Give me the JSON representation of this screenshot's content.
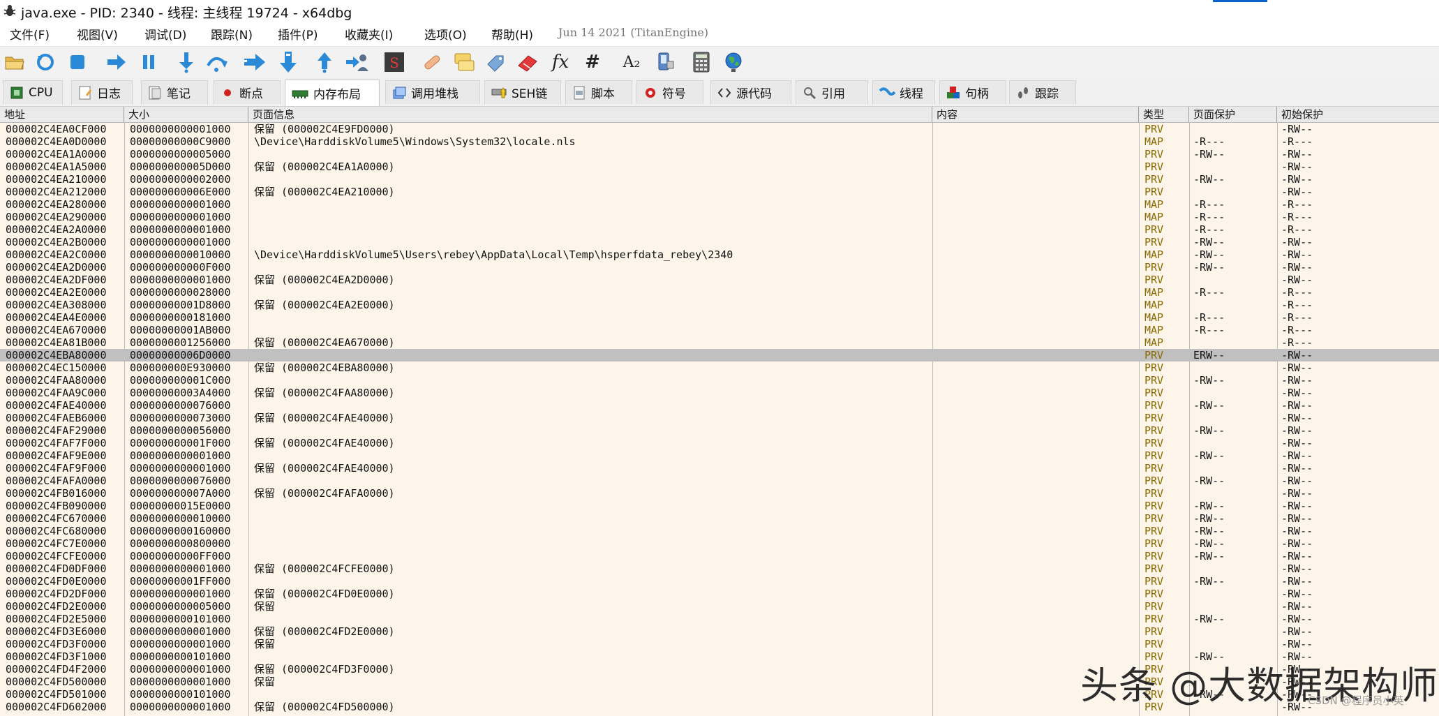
{
  "window": {
    "title": "java.exe - PID: 2340 - 线程: 主线程 19724 - x64dbg"
  },
  "menu": {
    "items": [
      "文件(F)",
      "视图(V)",
      "调试(D)",
      "跟踪(N)",
      "插件(P)",
      "收藏夹(I)",
      "选项(O)",
      "帮助(H)"
    ],
    "build_info": "Jun 14 2021 (TitanEngine)"
  },
  "toolbar": {
    "icons": [
      "open-icon",
      "restart-icon",
      "stop-icon",
      "run-icon",
      "pause-icon",
      "step-into-icon",
      "step-over-icon",
      "trace-into-icon",
      "trace-over-icon",
      "execute-till-return-icon",
      "run-to-user-code-icon",
      "scylla-icon",
      "patch-icon",
      "comments-icon",
      "labels-icon",
      "bookmarks-icon",
      "functions-icon",
      "variables-icon",
      "strings-icon",
      "calculator-icon",
      "device-icon",
      "globe-icon"
    ],
    "fx_label": "fx",
    "hash_label": "#",
    "a2_label": "A₂"
  },
  "tabs": [
    {
      "label": "CPU",
      "icon": "cpu-icon"
    },
    {
      "label": "日志",
      "icon": "log-icon"
    },
    {
      "label": "笔记",
      "icon": "notes-icon"
    },
    {
      "label": "断点",
      "icon": "breakpoint-icon"
    },
    {
      "label": "内存布局",
      "icon": "memory-icon",
      "active": true
    },
    {
      "label": "调用堆栈",
      "icon": "callstack-icon"
    },
    {
      "label": "SEH链",
      "icon": "seh-icon"
    },
    {
      "label": "脚本",
      "icon": "script-icon"
    },
    {
      "label": "符号",
      "icon": "symbols-icon"
    },
    {
      "label": "源代码",
      "icon": "source-icon"
    },
    {
      "label": "引用",
      "icon": "references-icon"
    },
    {
      "label": "线程",
      "icon": "threads-icon"
    },
    {
      "label": "句柄",
      "icon": "handles-icon"
    },
    {
      "label": "跟踪",
      "icon": "trace-icon"
    }
  ],
  "table": {
    "headers": [
      "地址",
      "大小",
      "页面信息",
      "内容",
      "类型",
      "页面保护",
      "初始保护"
    ],
    "rows": [
      [
        "000002C4EA0CF000",
        "0000000000001000",
        "保留 (000002C4E9FD0000)",
        "",
        "PRV",
        "",
        "-RW--"
      ],
      [
        "000002C4EA0D0000",
        "00000000000C9000",
        "\\Device\\HarddiskVolume5\\Windows\\System32\\locale.nls",
        "",
        "MAP",
        "-R---",
        "-R---"
      ],
      [
        "000002C4EA1A0000",
        "0000000000005000",
        "",
        "",
        "PRV",
        "-RW--",
        "-RW--"
      ],
      [
        "000002C4EA1A5000",
        "000000000005D000",
        "保留 (000002C4EA1A0000)",
        "",
        "PRV",
        "",
        "-RW--"
      ],
      [
        "000002C4EA210000",
        "0000000000002000",
        "",
        "",
        "PRV",
        "-RW--",
        "-RW--"
      ],
      [
        "000002C4EA212000",
        "000000000006E000",
        "保留 (000002C4EA210000)",
        "",
        "PRV",
        "",
        "-RW--"
      ],
      [
        "000002C4EA280000",
        "0000000000001000",
        "",
        "",
        "MAP",
        "-R---",
        "-R---"
      ],
      [
        "000002C4EA290000",
        "0000000000001000",
        "",
        "",
        "MAP",
        "-R---",
        "-R---"
      ],
      [
        "000002C4EA2A0000",
        "0000000000001000",
        "",
        "",
        "PRV",
        "-R---",
        "-R---"
      ],
      [
        "000002C4EA2B0000",
        "0000000000001000",
        "",
        "",
        "PRV",
        "-RW--",
        "-RW--"
      ],
      [
        "000002C4EA2C0000",
        "0000000000010000",
        "\\Device\\HarddiskVolume5\\Users\\rebey\\AppData\\Local\\Temp\\hsperfdata_rebey\\2340",
        "",
        "MAP",
        "-RW--",
        "-RW--"
      ],
      [
        "000002C4EA2D0000",
        "000000000000F000",
        "",
        "",
        "PRV",
        "-RW--",
        "-RW--"
      ],
      [
        "000002C4EA2DF000",
        "0000000000001000",
        "保留 (000002C4EA2D0000)",
        "",
        "PRV",
        "",
        "-RW--"
      ],
      [
        "000002C4EA2E0000",
        "0000000000028000",
        "",
        "",
        "MAP",
        "-R---",
        "-R---"
      ],
      [
        "000002C4EA308000",
        "00000000001D8000",
        "保留 (000002C4EA2E0000)",
        "",
        "MAP",
        "",
        "-R---"
      ],
      [
        "000002C4EA4E0000",
        "0000000000181000",
        "",
        "",
        "MAP",
        "-R---",
        "-R---"
      ],
      [
        "000002C4EA670000",
        "00000000001AB000",
        "",
        "",
        "MAP",
        "-R---",
        "-R---"
      ],
      [
        "000002C4EA81B000",
        "0000000001256000",
        "保留 (000002C4EA670000)",
        "",
        "MAP",
        "",
        "-R---"
      ],
      [
        "000002C4EBA80000",
        "00000000006D0000",
        "",
        "",
        "PRV",
        "ERW--",
        "-RW--"
      ],
      [
        "000002C4EC150000",
        "000000000E930000",
        "保留 (000002C4EBA80000)",
        "",
        "PRV",
        "",
        "-RW--"
      ],
      [
        "000002C4FAA80000",
        "000000000001C000",
        "",
        "",
        "PRV",
        "-RW--",
        "-RW--"
      ],
      [
        "000002C4FAA9C000",
        "00000000003A4000",
        "保留 (000002C4FAA80000)",
        "",
        "PRV",
        "",
        "-RW--"
      ],
      [
        "000002C4FAE40000",
        "0000000000076000",
        "",
        "",
        "PRV",
        "-RW--",
        "-RW--"
      ],
      [
        "000002C4FAEB6000",
        "0000000000073000",
        "保留 (000002C4FAE40000)",
        "",
        "PRV",
        "",
        "-RW--"
      ],
      [
        "000002C4FAF29000",
        "0000000000056000",
        "",
        "",
        "PRV",
        "-RW--",
        "-RW--"
      ],
      [
        "000002C4FAF7F000",
        "000000000001F000",
        "保留 (000002C4FAE40000)",
        "",
        "PRV",
        "",
        "-RW--"
      ],
      [
        "000002C4FAF9E000",
        "0000000000001000",
        "",
        "",
        "PRV",
        "-RW--",
        "-RW--"
      ],
      [
        "000002C4FAF9F000",
        "0000000000001000",
        "保留 (000002C4FAE40000)",
        "",
        "PRV",
        "",
        "-RW--"
      ],
      [
        "000002C4FAFA0000",
        "0000000000076000",
        "",
        "",
        "PRV",
        "-RW--",
        "-RW--"
      ],
      [
        "000002C4FB016000",
        "000000000007A000",
        "保留 (000002C4FAFA0000)",
        "",
        "PRV",
        "",
        "-RW--"
      ],
      [
        "000002C4FB090000",
        "00000000015E0000",
        "",
        "",
        "PRV",
        "-RW--",
        "-RW--"
      ],
      [
        "000002C4FC670000",
        "0000000000010000",
        "",
        "",
        "PRV",
        "-RW--",
        "-RW--"
      ],
      [
        "000002C4FC680000",
        "0000000000160000",
        "",
        "",
        "PRV",
        "-RW--",
        "-RW--"
      ],
      [
        "000002C4FC7E0000",
        "0000000000800000",
        "",
        "",
        "PRV",
        "-RW--",
        "-RW--"
      ],
      [
        "000002C4FCFE0000",
        "00000000000FF000",
        "",
        "",
        "PRV",
        "-RW--",
        "-RW--"
      ],
      [
        "000002C4FD0DF000",
        "0000000000001000",
        "保留 (000002C4FCFE0000)",
        "",
        "PRV",
        "",
        "-RW--"
      ],
      [
        "000002C4FD0E0000",
        "00000000001FF000",
        "",
        "",
        "PRV",
        "-RW--",
        "-RW--"
      ],
      [
        "000002C4FD2DF000",
        "0000000000001000",
        "保留 (000002C4FD0E0000)",
        "",
        "PRV",
        "",
        "-RW--"
      ],
      [
        "000002C4FD2E0000",
        "0000000000005000",
        "保留",
        "",
        "PRV",
        "",
        "-RW--"
      ],
      [
        "000002C4FD2E5000",
        "0000000000101000",
        "",
        "",
        "PRV",
        "-RW--",
        "-RW--"
      ],
      [
        "000002C4FD3E6000",
        "0000000000001000",
        "保留 (000002C4FD2E0000)",
        "",
        "PRV",
        "",
        "-RW--"
      ],
      [
        "000002C4FD3F0000",
        "0000000000001000",
        "保留",
        "",
        "PRV",
        "",
        "-RW--"
      ],
      [
        "000002C4FD3F1000",
        "0000000000101000",
        "",
        "",
        "PRV",
        "-RW--",
        "-RW--"
      ],
      [
        "000002C4FD4F2000",
        "0000000000001000",
        "保留 (000002C4FD3F0000)",
        "",
        "PRV",
        "",
        "-RW--"
      ],
      [
        "000002C4FD500000",
        "0000000000001000",
        "保留",
        "",
        "PRV",
        "",
        "-RW--"
      ],
      [
        "000002C4FD501000",
        "0000000000101000",
        "",
        "",
        "PRV",
        "-RW--",
        "-RW--"
      ],
      [
        "000002C4FD602000",
        "0000000000001000",
        "保留 (000002C4FD500000)",
        "",
        "PRV",
        "",
        "-RW--"
      ]
    ],
    "selected_row": 18
  },
  "watermark": {
    "main": "头条 @大数据架构师",
    "sub": "CSDN @程序员小英"
  },
  "colors": {
    "table_bg": "#fdf5ea",
    "selected_row": "#c0c0c0",
    "type_text": "#8a6a00",
    "active_tab": "#ffffff"
  }
}
